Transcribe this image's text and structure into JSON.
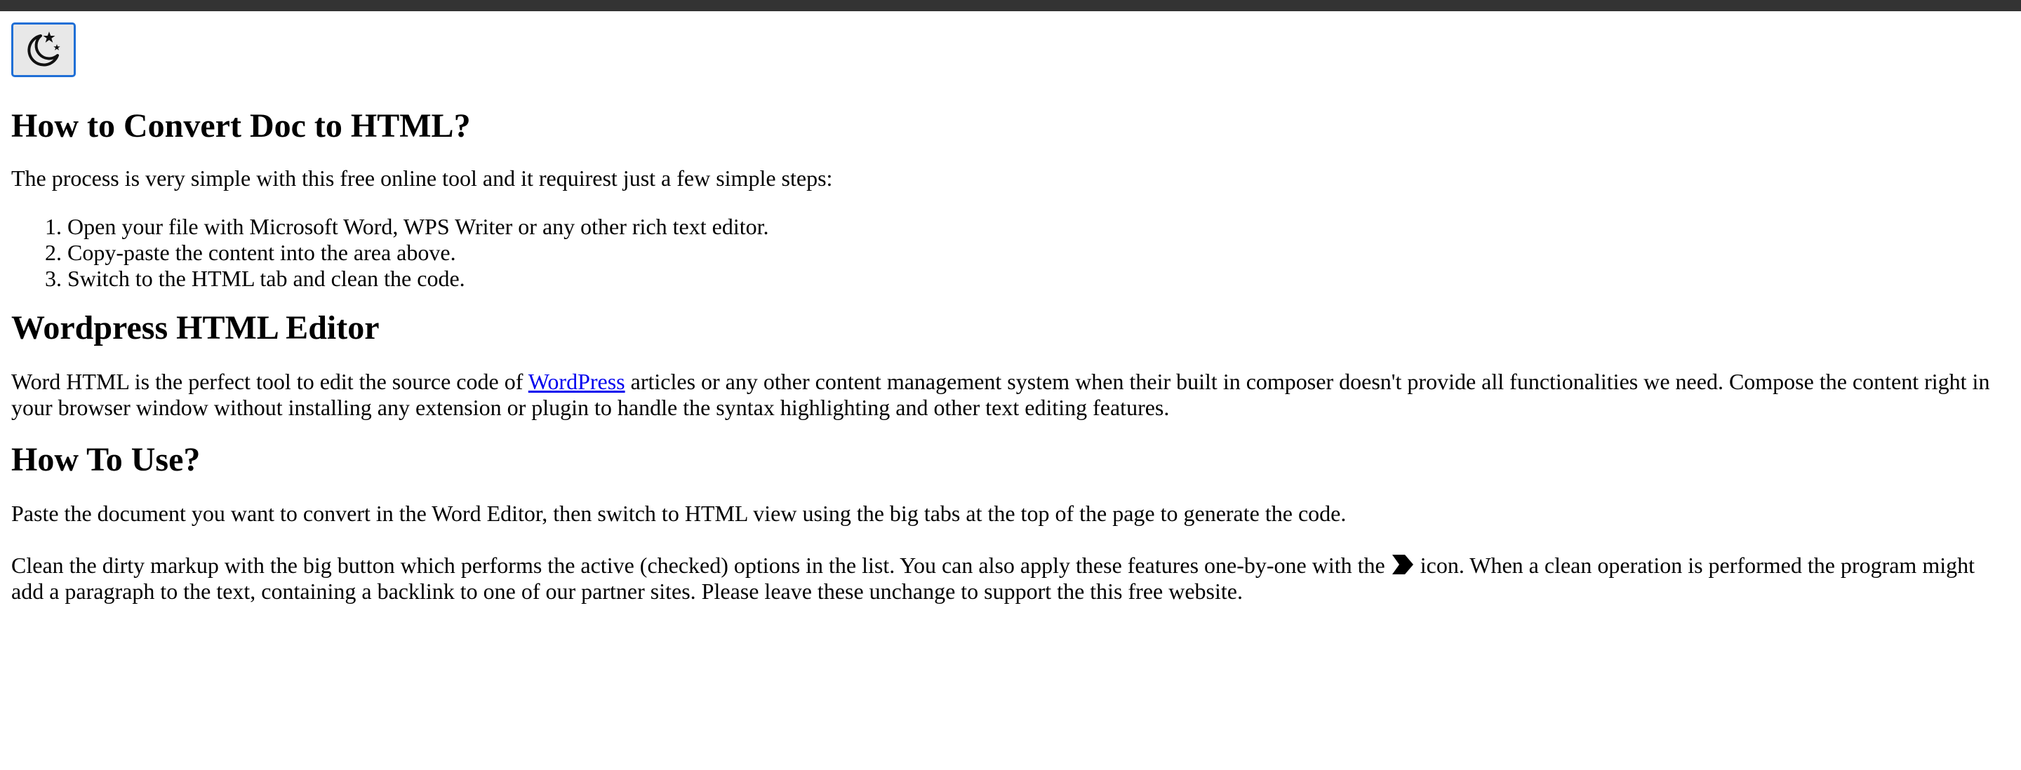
{
  "icons": {
    "theme_toggle": "moon-stars-icon",
    "clean_operation": "chevron-right-icon"
  },
  "colors": {
    "topbar": "#333333",
    "toggle_border": "#1f6fd6",
    "link": "#0000ee"
  },
  "sections": {
    "convert": {
      "heading": "How to Convert Doc to HTML?",
      "intro": "The process is very simple with this free online tool and it requirest just a few simple steps:",
      "steps": [
        "Open your file with Microsoft Word, WPS Writer or any other rich text editor.",
        "Copy-paste the content into the area above.",
        "Switch to the HTML tab and clean the code."
      ]
    },
    "wordpress": {
      "heading": "Wordpress HTML Editor",
      "text_before_link": "Word HTML is the perfect tool to edit the source code of ",
      "link_text": "WordPress",
      "text_after_link": " articles or any other content management system when their built in composer doesn't provide all functionalities we need. Compose the content right in your browser window without installing any extension or plugin to handle the syntax highlighting and other text editing features."
    },
    "how_to_use": {
      "heading": "How To Use?",
      "paragraph1": "Paste the document you want to convert in the Word Editor, then switch to HTML view using the big tabs at the top of the page to generate the code.",
      "paragraph2_before_icon": "Clean the dirty markup with the big button which performs the active (checked) options in the list. You can also apply these features one-by-one with the ",
      "paragraph2_after_icon": " icon. When a clean operation is performed the program might add a paragraph to the text, containing a backlink to one of our partner sites. Please leave these unchange to support the this free website."
    }
  }
}
